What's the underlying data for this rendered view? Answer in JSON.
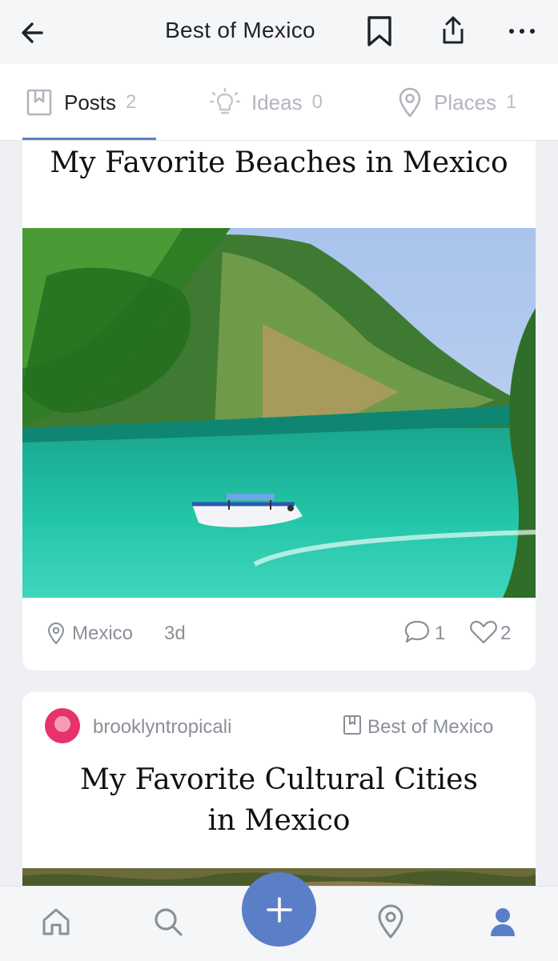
{
  "header": {
    "title": "Best of Mexico",
    "back_icon": "arrow-left-icon",
    "bookmark_icon": "bookmark-icon",
    "share_icon": "share-icon",
    "more_icon": "more-dots-icon"
  },
  "tabs": [
    {
      "label": "Posts",
      "count": "2",
      "icon": "collection-icon",
      "active": true
    },
    {
      "label": "Ideas",
      "count": "0",
      "icon": "lightbulb-icon",
      "active": false
    },
    {
      "label": "Places",
      "count": "1",
      "icon": "location-pin-icon",
      "active": false
    }
  ],
  "posts": [
    {
      "title": "My Favorite Beaches in Mexico",
      "location": "Mexico",
      "time": "3d",
      "comments": "1",
      "likes": "2"
    },
    {
      "user": "brooklyntropicali",
      "collection": "Best of Mexico",
      "title_line1": "My Favorite Cultural Cities",
      "title_line2": "in Mexico"
    }
  ],
  "bottom_nav": {
    "items": [
      "home-icon",
      "search-icon",
      "add-icon",
      "map-pin-icon",
      "profile-icon"
    ],
    "accent": "#5b7fc7"
  },
  "colors": {
    "accent": "#5b7fc7",
    "muted_text": "#8a8f98",
    "background": "#eef0f4"
  }
}
